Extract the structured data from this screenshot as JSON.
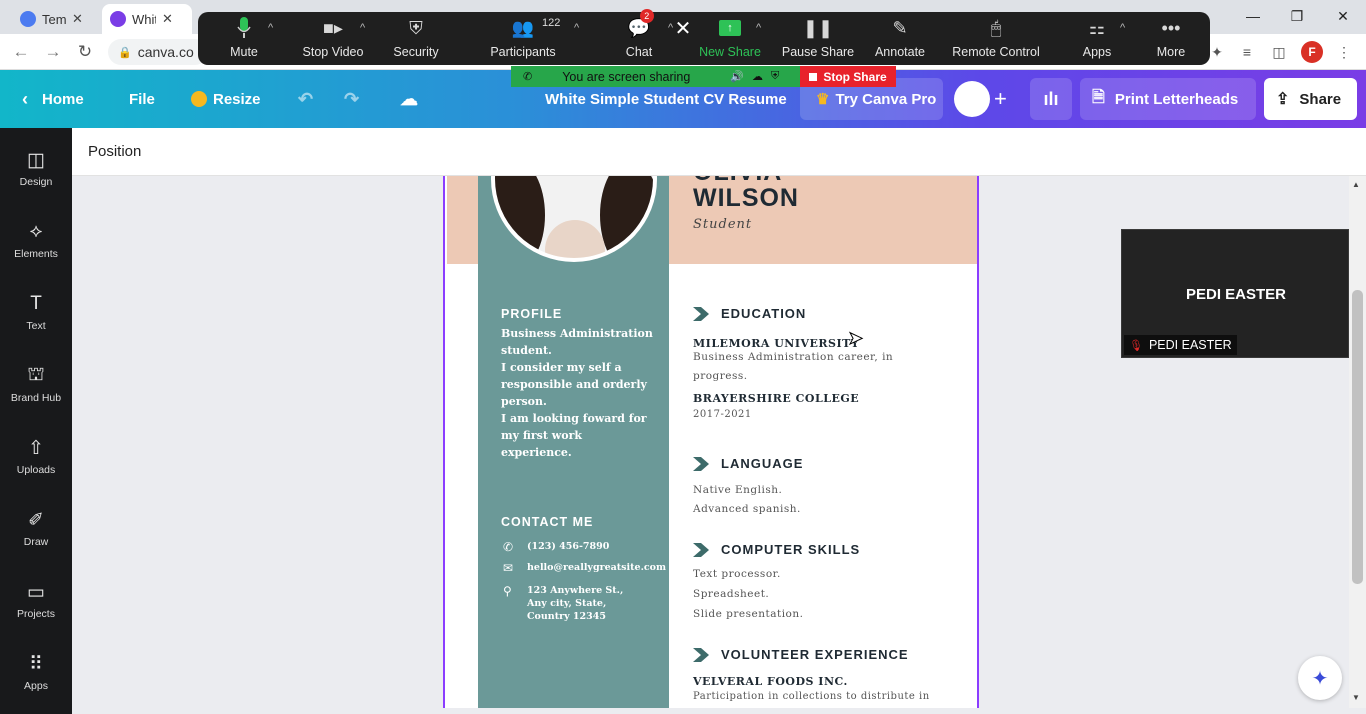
{
  "browser": {
    "tabs": [
      {
        "label": "Temp",
        "color": "#4c7bf0"
      },
      {
        "label": "Whit",
        "color": "#7a3de6"
      }
    ],
    "url": "canva.co",
    "profile_initial": "F"
  },
  "zoom": {
    "mute": "Mute",
    "stop_video": "Stop Video",
    "security": "Security",
    "participants": "Participants",
    "participant_count": "122",
    "chat": "Chat",
    "chat_badge": "2",
    "new_share": "New Share",
    "pause_share": "Pause Share",
    "annotate": "Annotate",
    "remote_control": "Remote Control",
    "apps": "Apps",
    "more": "More",
    "sharing_status": "You are screen sharing",
    "stop_share": "Stop Share"
  },
  "canva": {
    "home": "Home",
    "file": "File",
    "resize": "Resize",
    "doc_title": "White Simple Student CV Resume",
    "try_pro": "Try Canva Pro",
    "print": "Print Letterheads",
    "share": "Share",
    "position_label": "Position",
    "sidebar": [
      {
        "label": "Design",
        "icon": "design-icon"
      },
      {
        "label": "Elements",
        "icon": "elements-icon"
      },
      {
        "label": "Text",
        "icon": "text-icon"
      },
      {
        "label": "Brand Hub",
        "icon": "brand-hub-icon"
      },
      {
        "label": "Uploads",
        "icon": "uploads-icon"
      },
      {
        "label": "Draw",
        "icon": "draw-icon"
      },
      {
        "label": "Projects",
        "icon": "projects-icon"
      },
      {
        "label": "Apps",
        "icon": "apps-icon"
      }
    ]
  },
  "resume": {
    "first_name": "OLIVIA",
    "last_name": "WILSON",
    "role": "Student",
    "profile_heading": "PROFILE",
    "profile_lines": [
      "Business Administration",
      "student.",
      "I consider my self a",
      "responsible and orderly",
      "person.",
      "I am looking foward for",
      "my first work",
      "experience."
    ],
    "contact_heading": "CONTACT ME",
    "phone": "(123) 456-7890",
    "email": "hello@reallygreatsite.com",
    "address": [
      "123 Anywhere St.,",
      "Any city, State,",
      "Country 12345"
    ],
    "education_heading": "EDUCATION",
    "school1": "MILEMORA UNIVERSITY",
    "school1_desc": [
      "Business Administration career, in",
      "progress."
    ],
    "school2": "BRAYERSHIRE COLLEGE",
    "school2_years": "2017-2021",
    "language_heading": "LANGUAGE",
    "languages": [
      "Native English.",
      "Advanced spanish."
    ],
    "skills_heading": "COMPUTER SKILLS",
    "skills": [
      "Text processor.",
      "Spreadsheet.",
      "Slide presentation."
    ],
    "volunteer_heading": "VOLUNTEER EXPERIENCE",
    "volunteer_org": "VELVERAL FOODS INC.",
    "volunteer_desc": "Participation in collections to distribute in"
  },
  "video": {
    "name": "PEDI EASTER",
    "label": "PEDI EASTER"
  },
  "colors": {
    "teal": "#6b9998",
    "peach": "#edc9b5",
    "canva_purple": "#7a3de6",
    "zoom_green": "#27a64a",
    "zoom_red": "#e8222b"
  }
}
